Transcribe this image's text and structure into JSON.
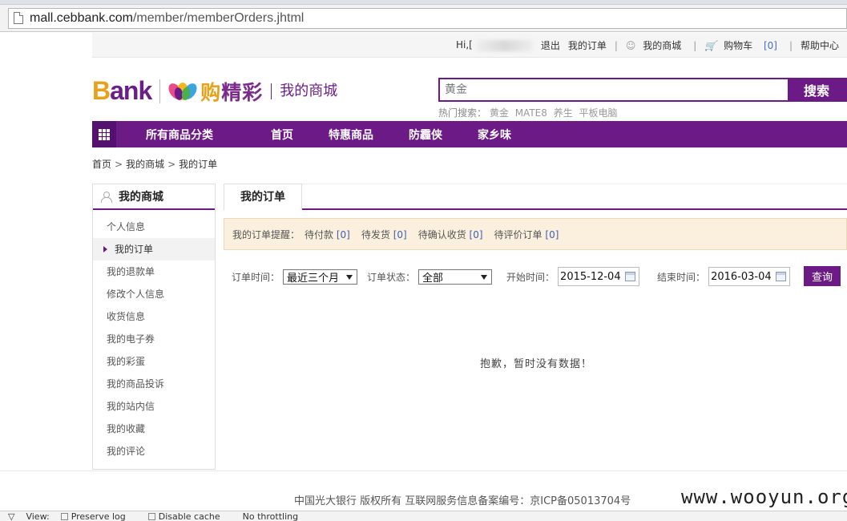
{
  "browser": {
    "url_host": "mall.cebbank.com",
    "url_path": "/member/memberOrders.jhtml"
  },
  "topbar": {
    "greeting": "Hi,[",
    "logout": "退出",
    "my_orders": "我的订单",
    "my_mall": "我的商城",
    "cart": "购物车",
    "cart_count": "[0]",
    "help": "帮助中心"
  },
  "header": {
    "logo_b": "B",
    "logo_rest": "ank",
    "logo_gou": "购",
    "logo_jingcai": "精彩",
    "mall_title": "我的商城",
    "search_placeholder": "黄金",
    "search_button": "搜索",
    "hot_label": "热门搜索：",
    "hot_terms": [
      "黄金",
      "MATE8",
      "养生",
      "平板电脑"
    ]
  },
  "nav": {
    "all_categories": "所有商品分类",
    "links": [
      "首页",
      "特惠商品",
      "防霾侠",
      "家乡味"
    ]
  },
  "breadcrumb": [
    "首页",
    "我的商城",
    "我的订单"
  ],
  "sidebar": {
    "title": "我的商城",
    "items": [
      "个人信息",
      "我的订单",
      "我的退款单",
      "修改个人信息",
      "收货信息",
      "我的电子券",
      "我的彩蛋",
      "我的商品投诉",
      "我的站内信",
      "我的收藏",
      "我的评论"
    ],
    "active_index": 1
  },
  "main": {
    "tab_label": "我的订单",
    "reminder": {
      "label": "我的订单提醒：",
      "items": [
        {
          "label": "待付款",
          "count": "[0]"
        },
        {
          "label": "待发货",
          "count": "[0]"
        },
        {
          "label": "待确认收货",
          "count": "[0]"
        },
        {
          "label": "待评价订单",
          "count": "[0]"
        }
      ]
    },
    "filter": {
      "time_label": "订单时间：",
      "time_value": "最近三个月",
      "status_label": "订单状态：",
      "status_value": "全部",
      "start_label": "开始时间：",
      "start_value": "2015-12-04",
      "end_label": "结束时间：",
      "end_value": "2016-03-04",
      "query_button": "查询"
    },
    "empty_message": "抱歉，暂时没有数据！"
  },
  "footer": {
    "text": "中国光大银行 版权所有 互联网服务信息备案编号：京ICP备05013704号",
    "watermark": "www.wooyun.org"
  },
  "devtools": {
    "view": "View:",
    "preserve_log": "Preserve log",
    "disable_cache": "Disable cache",
    "throttling": "No throttling"
  },
  "colors": {
    "brand_purple": "#6c1a86",
    "brand_gold": "#e8a11a",
    "reminder_bg": "#fbf0dd"
  }
}
